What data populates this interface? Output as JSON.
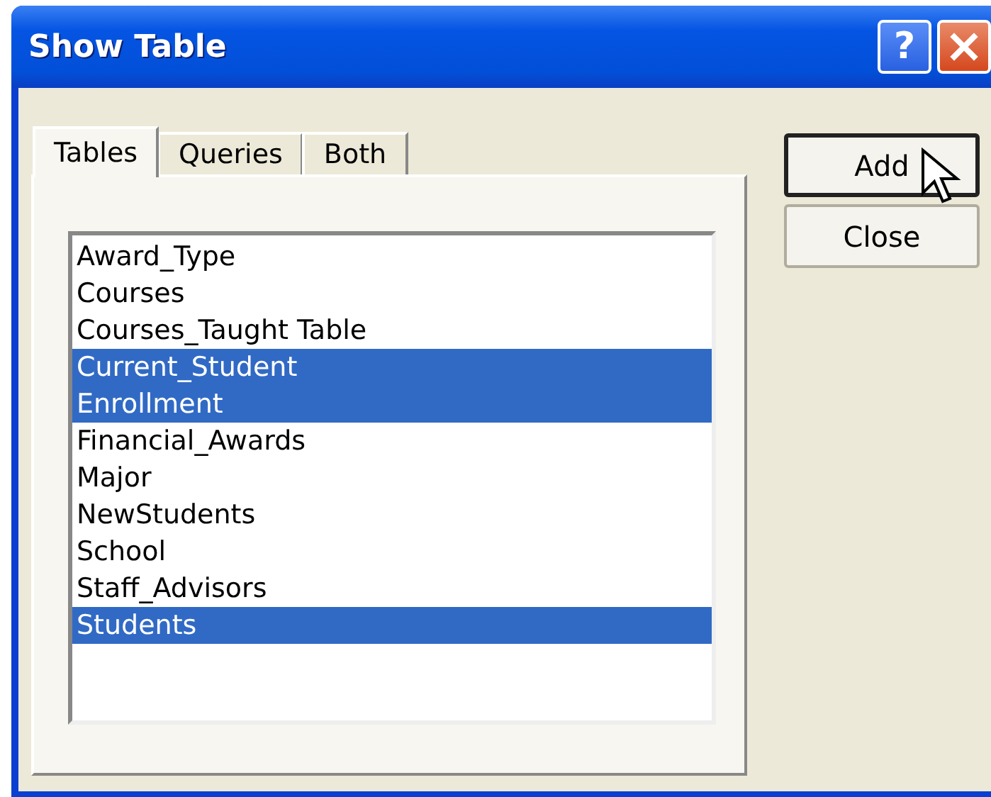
{
  "window": {
    "title": "Show Table"
  },
  "title_buttons": [
    {
      "kind": "help",
      "label": "?"
    },
    {
      "kind": "close"
    }
  ],
  "tabs": [
    {
      "label": "Tables",
      "selected": true
    },
    {
      "label": "Queries",
      "selected": false
    },
    {
      "label": "Both",
      "selected": false
    }
  ],
  "list": {
    "items": [
      {
        "label": "Award_Type",
        "selected": false
      },
      {
        "label": "Courses",
        "selected": false
      },
      {
        "label": "Courses_Taught Table",
        "selected": false
      },
      {
        "label": "Current_Student",
        "selected": true
      },
      {
        "label": "Enrollment",
        "selected": true
      },
      {
        "label": "Financial_Awards",
        "selected": false
      },
      {
        "label": "Major",
        "selected": false
      },
      {
        "label": "NewStudents",
        "selected": false
      },
      {
        "label": "School",
        "selected": false
      },
      {
        "label": "Staff_Advisors",
        "selected": false
      },
      {
        "label": "Students",
        "selected": true
      }
    ]
  },
  "buttons": [
    {
      "label": "Add",
      "default": true
    },
    {
      "label": "Close",
      "default": false
    }
  ]
}
